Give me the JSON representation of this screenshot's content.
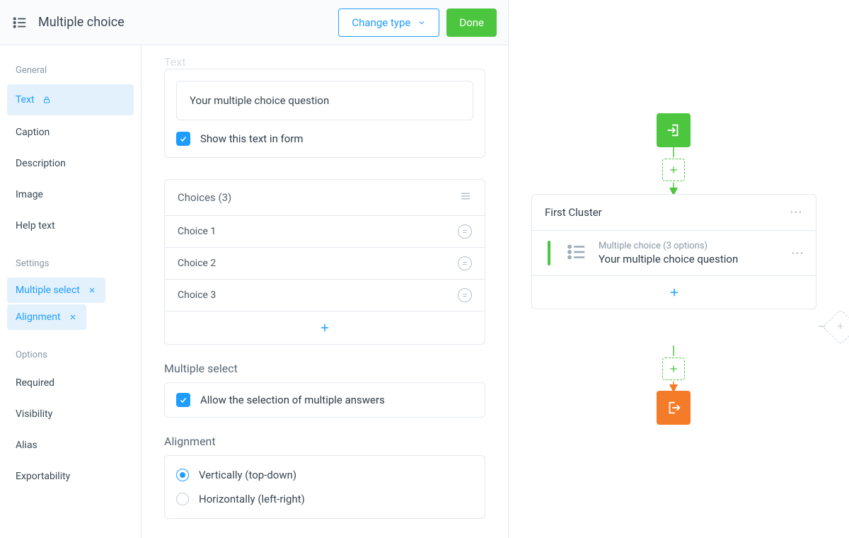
{
  "header": {
    "title": "Multiple choice",
    "change_type": "Change type",
    "done": "Done"
  },
  "sidebar": {
    "groups": [
      {
        "title": "General",
        "items": [
          {
            "label": "Text",
            "active": true,
            "icon": "lock"
          },
          {
            "label": "Caption"
          },
          {
            "label": "Description"
          },
          {
            "label": "Image"
          },
          {
            "label": "Help text"
          }
        ]
      },
      {
        "title": "Settings",
        "items": [
          {
            "label": "Multiple select",
            "active": true,
            "removable": true
          },
          {
            "label": "Alignment",
            "active": true,
            "removable": true
          }
        ]
      },
      {
        "title": "Options",
        "items": [
          {
            "label": "Required"
          },
          {
            "label": "Visibility"
          },
          {
            "label": "Alias"
          },
          {
            "label": "Exportability"
          }
        ]
      }
    ]
  },
  "content": {
    "text_section_label": "Text",
    "text_input_placeholder": "Your multiple choice question",
    "show_in_form": "Show this text in form",
    "choices_header": "Choices (3)",
    "choices": [
      "Choice 1",
      "Choice 2",
      "Choice 3"
    ],
    "multiple_select_label": "Multiple select",
    "allow_multiple": "Allow the selection of multiple answers",
    "alignment_label": "Alignment",
    "align_vertical": "Vertically (top-down)",
    "align_horizontal": "Horizontally (left-right)"
  },
  "canvas": {
    "cluster_title": "First Cluster",
    "mc_meta": "Multiple choice (3 options)",
    "mc_question": "Your multiple choice question"
  }
}
